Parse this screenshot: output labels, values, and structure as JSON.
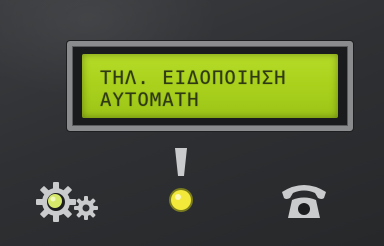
{
  "display": {
    "line1": "ΤΗΛ. ΕΙΔΟΠΟΙΗΣΗ",
    "line2": "ΑΥΤΟΜΑΤΗ"
  },
  "indicators": {
    "settings": {
      "icon": "gears-icon",
      "led_color": "#d6e86a"
    },
    "alert": {
      "icon": "exclamation-icon",
      "led_color": "#f2e93a"
    },
    "phone": {
      "icon": "telephone-icon"
    }
  },
  "colors": {
    "lcd_background": "#abd21e",
    "lcd_text": "#2f3a14",
    "panel": "#2e3033",
    "bezel": "#8a8c8e",
    "icon": "#c9cbcc"
  }
}
